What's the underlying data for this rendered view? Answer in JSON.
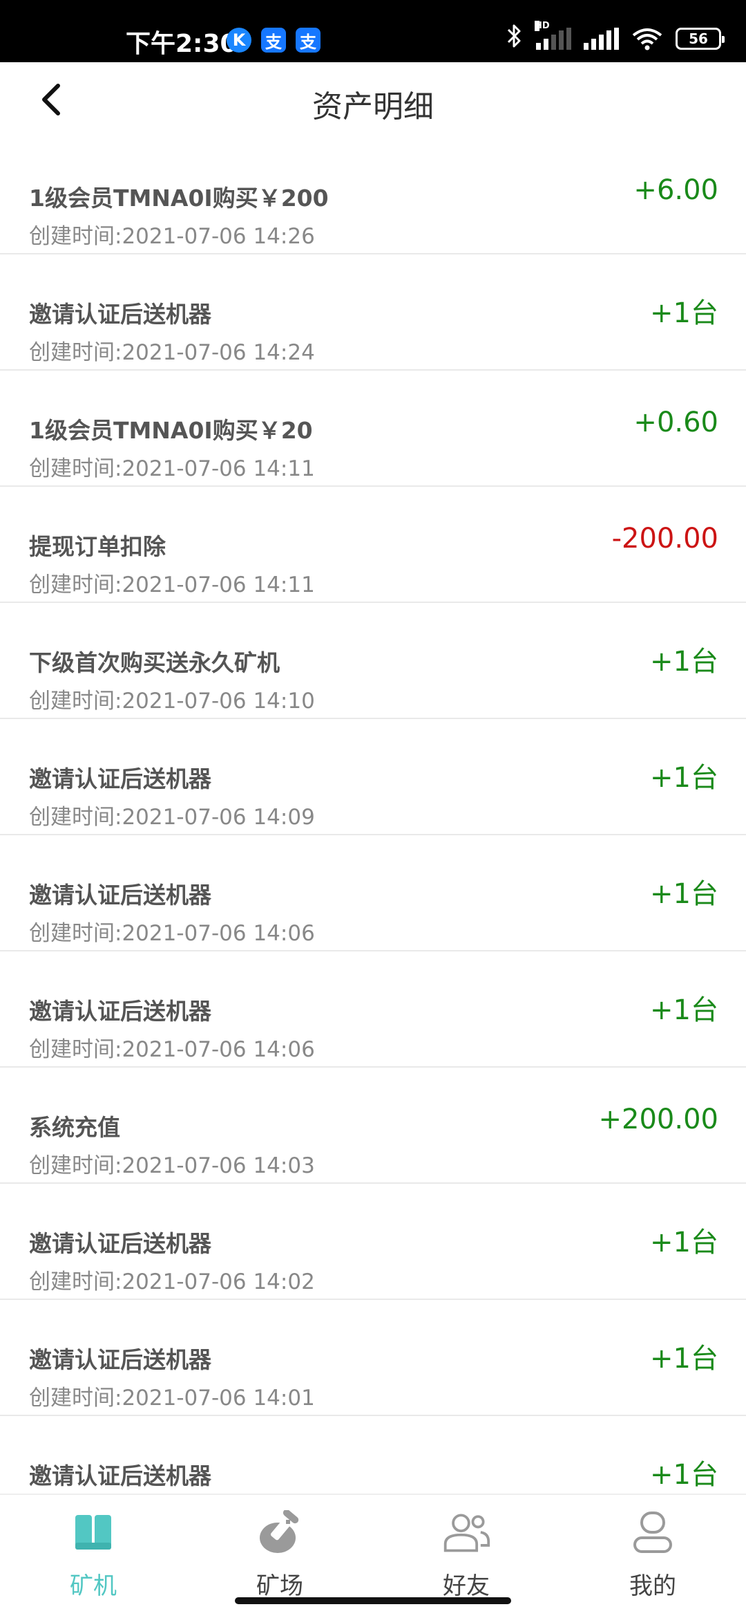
{
  "status_bar": {
    "time": "下午2:30",
    "apps": [
      "K",
      "支",
      "支"
    ],
    "battery": "56",
    "hd": "HD"
  },
  "header": {
    "title": "资产明细"
  },
  "records": [
    {
      "title": "1级会员TMNA0I购买￥200",
      "time": "创建时间:2021-07-06 14:26",
      "amount": "+6.00",
      "type": "pos"
    },
    {
      "title": "邀请认证后送机器",
      "time": "创建时间:2021-07-06 14:24",
      "amount": "+1台",
      "type": "pos"
    },
    {
      "title": "1级会员TMNA0I购买￥20",
      "time": "创建时间:2021-07-06 14:11",
      "amount": "+0.60",
      "type": "pos"
    },
    {
      "title": "提现订单扣除",
      "time": "创建时间:2021-07-06 14:11",
      "amount": "-200.00",
      "type": "neg"
    },
    {
      "title": "下级首次购买送永久矿机",
      "time": "创建时间:2021-07-06 14:10",
      "amount": "+1台",
      "type": "pos"
    },
    {
      "title": "邀请认证后送机器",
      "time": "创建时间:2021-07-06 14:09",
      "amount": "+1台",
      "type": "pos"
    },
    {
      "title": "邀请认证后送机器",
      "time": "创建时间:2021-07-06 14:06",
      "amount": "+1台",
      "type": "pos"
    },
    {
      "title": "邀请认证后送机器",
      "time": "创建时间:2021-07-06 14:06",
      "amount": "+1台",
      "type": "pos"
    },
    {
      "title": "系统充值",
      "time": "创建时间:2021-07-06 14:03",
      "amount": "+200.00",
      "type": "pos"
    },
    {
      "title": "邀请认证后送机器",
      "time": "创建时间:2021-07-06 14:02",
      "amount": "+1台",
      "type": "pos"
    },
    {
      "title": "邀请认证后送机器",
      "time": "创建时间:2021-07-06 14:01",
      "amount": "+1台",
      "type": "pos"
    },
    {
      "title": "邀请认证后送机器",
      "time": "",
      "amount": "+1台",
      "type": "pos"
    }
  ],
  "tabs": [
    {
      "label": "矿机",
      "icon": "miner-icon",
      "active": true
    },
    {
      "label": "矿场",
      "icon": "mine-field-icon",
      "active": false
    },
    {
      "label": "好友",
      "icon": "friends-icon",
      "active": false
    },
    {
      "label": "我的",
      "icon": "profile-icon",
      "active": false
    }
  ],
  "colors": {
    "positive": "#1a8a1a",
    "negative": "#cc1414",
    "accent": "#52c7c3",
    "inactive_icon": "#9a9a9a"
  }
}
